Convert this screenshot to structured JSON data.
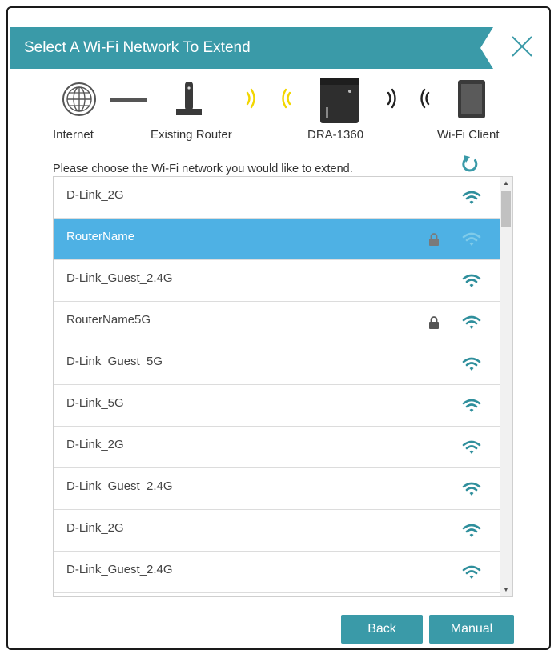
{
  "dialog": {
    "title": "Select A Wi-Fi Network To Extend",
    "accent_color": "#3a9aa8",
    "selected_color": "#4eb1e4"
  },
  "topology": {
    "labels": [
      "Internet",
      "Existing Router",
      "DRA-1360",
      "Wi-Fi Client"
    ]
  },
  "instruction": "Please choose the Wi-Fi network you would like to extend.",
  "networks": [
    {
      "ssid": "D-Link_2G",
      "locked": false,
      "selected": false
    },
    {
      "ssid": "RouterName",
      "locked": true,
      "selected": true
    },
    {
      "ssid": "D-Link_Guest_2.4G",
      "locked": false,
      "selected": false
    },
    {
      "ssid": "RouterName5G",
      "locked": true,
      "selected": false
    },
    {
      "ssid": "D-Link_Guest_5G",
      "locked": false,
      "selected": false
    },
    {
      "ssid": "D-Link_5G",
      "locked": false,
      "selected": false
    },
    {
      "ssid": "D-Link_2G",
      "locked": false,
      "selected": false
    },
    {
      "ssid": "D-Link_Guest_2.4G",
      "locked": false,
      "selected": false
    },
    {
      "ssid": "D-Link_2G",
      "locked": false,
      "selected": false
    },
    {
      "ssid": "D-Link_Guest_2.4G",
      "locked": false,
      "selected": false
    }
  ],
  "buttons": {
    "back": "Back",
    "manual": "Manual"
  },
  "icons": {
    "close": "close-icon",
    "refresh": "refresh-icon",
    "wifi": "wifi-signal-icon",
    "lock": "lock-icon"
  }
}
